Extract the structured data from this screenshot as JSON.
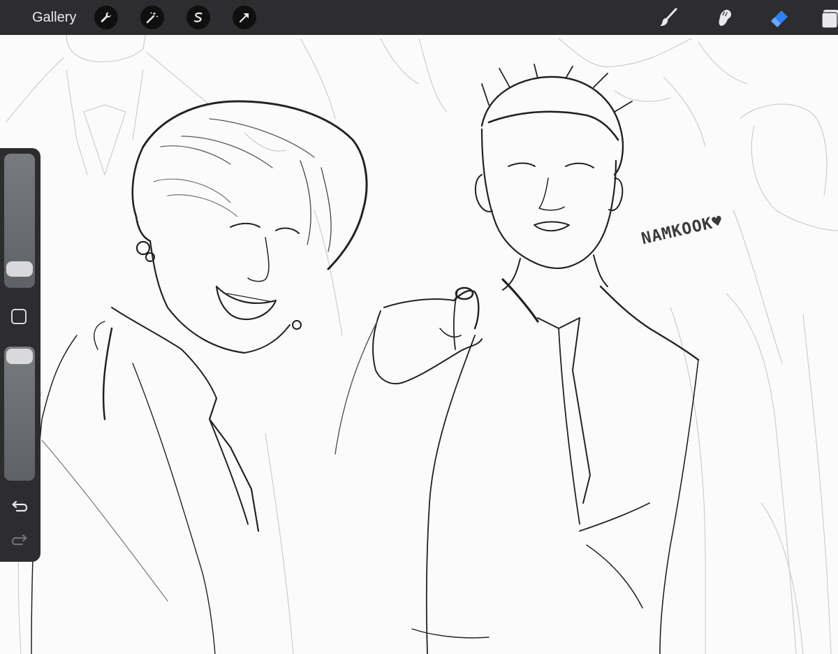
{
  "topbar": {
    "gallery_label": "Gallery",
    "left_tools": [
      "wrench-icon",
      "magic-wand-icon",
      "selection-icon",
      "transform-arrow-icon"
    ],
    "right_tools": [
      "brush-icon",
      "smudge-icon",
      "eraser-icon",
      "layers-icon"
    ],
    "active_tool": "eraser-icon"
  },
  "sidebar": {
    "brush_size_level": 0.18,
    "opacity_level": 1.0,
    "controls": [
      "brush-size-slider",
      "modify-button",
      "opacity-slider",
      "undo-icon",
      "redo-icon"
    ]
  },
  "canvas": {
    "signature": "NAMKOOK♥"
  },
  "colors": {
    "toolbar_bg": "#2d2d2f",
    "canvas_bg": "#fbfbfc",
    "active_tool_blue": "#2f80f5",
    "icon_light": "#e9e9ec"
  }
}
